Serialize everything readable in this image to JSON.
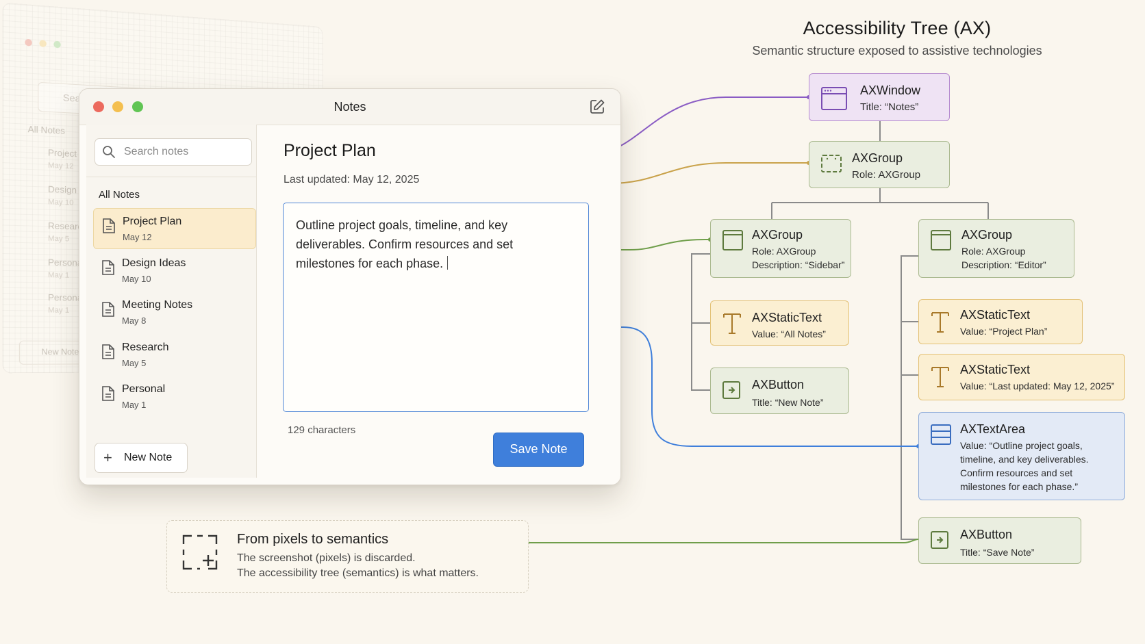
{
  "header": {
    "title": "Accessibility Tree (AX)",
    "subtitle": "Semantic structure exposed to assistive technologies"
  },
  "ghost_window": {
    "search_placeholder": "Searc",
    "section": "All Notes",
    "items": [
      {
        "title": "Project P",
        "date": "May 12"
      },
      {
        "title": "Design I",
        "date": "May 10"
      },
      {
        "title": "Research",
        "date": "May 5"
      },
      {
        "title": "Persona",
        "date": "May 1"
      },
      {
        "title": "Persona",
        "date": "May 1"
      }
    ],
    "new_button": "New Note"
  },
  "window": {
    "title": "Notes",
    "sidebar": {
      "search_placeholder": "Search notes",
      "section_label": "All Notes",
      "notes": [
        {
          "title": "Project Plan",
          "date": "May 12",
          "selected": true
        },
        {
          "title": "Design Ideas",
          "date": "May 10",
          "selected": false
        },
        {
          "title": "Meeting Notes",
          "date": "May 8",
          "selected": false
        },
        {
          "title": "Research",
          "date": "May 5",
          "selected": false
        },
        {
          "title": "Personal",
          "date": "May 1",
          "selected": false
        }
      ],
      "new_note_label": "New Note"
    },
    "editor": {
      "title": "Project Plan",
      "updated": "Last updated: May 12, 2025",
      "body": "Outline project goals, timeline, and key deliverables. Confirm resources and set milestones for each phase.",
      "char_count": "129 characters",
      "save_label": "Save Note"
    }
  },
  "caption": {
    "heading": "From pixels to semantics",
    "line1": "The screenshot (pixels) is discarded.",
    "line2": "The accessibility tree (semantics) is what matters."
  },
  "ax_nodes": {
    "window": {
      "name": "AXWindow",
      "line1": "Title: “Notes”"
    },
    "group_root": {
      "name": "AXGroup",
      "line1": "Role: AXGroup"
    },
    "group_sidebar": {
      "name": "AXGroup",
      "line1": "Role: AXGroup",
      "line2": "Description: “Sidebar”"
    },
    "text_all_notes": {
      "name": "AXStaticText",
      "line1": "Value: “All Notes”"
    },
    "button_new_note": {
      "name": "AXButton",
      "line1": "Title: “New Note”"
    },
    "group_editor": {
      "name": "AXGroup",
      "line1": "Role: AXGroup",
      "line2": "Description: “Editor”"
    },
    "text_project_plan": {
      "name": "AXStaticText",
      "line1": "Value: “Project Plan”"
    },
    "text_last_updated": {
      "name": "AXStaticText",
      "line1": "Value: “Last updated: May 12, 2025”"
    },
    "textarea": {
      "name": "AXTextArea",
      "line1": "Value: “Outline project goals,",
      "line2": "timeline, and key deliverables.",
      "line3": "Confirm resources and set",
      "line4": "milestones for each phase.”"
    },
    "button_save": {
      "name": "AXButton",
      "line1": "Title: “Save Note”"
    }
  },
  "colors": {
    "purple": "#8a5cc4",
    "yellow": "#d3a23c",
    "green": "#6f9e4a",
    "blue": "#3f7fdb"
  }
}
